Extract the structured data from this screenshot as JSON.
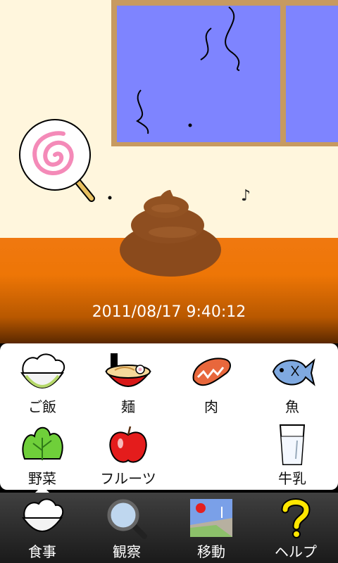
{
  "status": {
    "datetime": "2011/08/17 9:40:12"
  },
  "scene": {
    "music_note": "♪"
  },
  "food_menu": {
    "items": [
      {
        "label": "ご飯",
        "icon": "rice-bowl-icon"
      },
      {
        "label": "麺",
        "icon": "ramen-icon"
      },
      {
        "label": "肉",
        "icon": "meat-icon"
      },
      {
        "label": "魚",
        "icon": "fish-icon"
      },
      {
        "label": "野菜",
        "icon": "lettuce-icon"
      },
      {
        "label": "フルーツ",
        "icon": "apple-icon"
      },
      {
        "label": "牛乳",
        "icon": "milk-glass-icon"
      }
    ]
  },
  "tabs": [
    {
      "label": "食事",
      "icon": "rice-bowl-icon"
    },
    {
      "label": "観察",
      "icon": "magnifier-icon"
    },
    {
      "label": "移動",
      "icon": "landscape-icon"
    },
    {
      "label": "ヘルプ",
      "icon": "question-mark-icon"
    }
  ],
  "colors": {
    "wall": "#fff6dd",
    "floor": "#f07810",
    "window_glass": "#7e84ff",
    "window_frame": "#c79a60"
  }
}
